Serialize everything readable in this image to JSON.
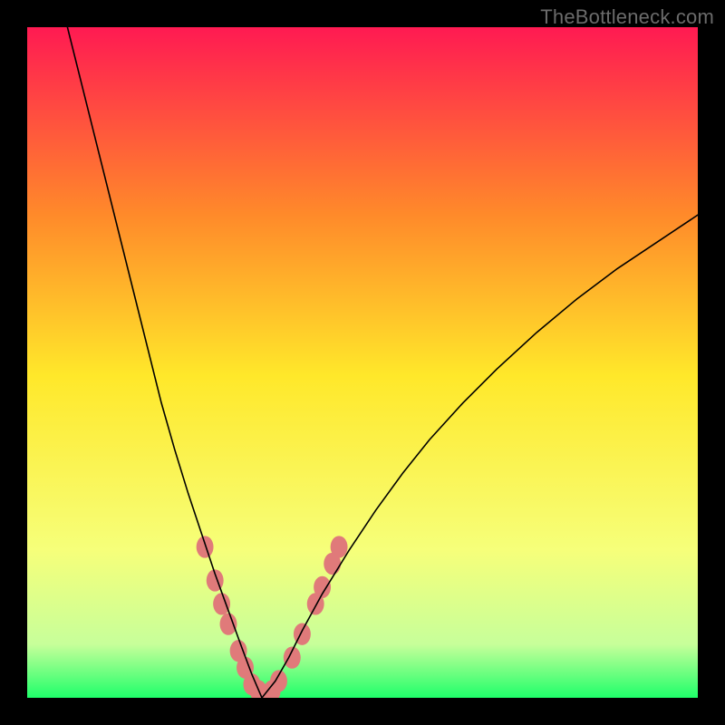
{
  "watermark": "TheBottleneck.com",
  "chart_data": {
    "type": "line",
    "title": "",
    "xlabel": "",
    "ylabel": "",
    "xlim": [
      0,
      100
    ],
    "ylim": [
      0,
      100
    ],
    "background_gradient": {
      "top": "#ff1a52",
      "mid_upper": "#ff8a2a",
      "mid": "#ffe82a",
      "mid_lower": "#f6ff7a",
      "lower": "#c7ff9a",
      "bottom": "#1fff6a"
    },
    "series": [
      {
        "name": "curve-left",
        "color": "#000000",
        "stroke_width": 1.6,
        "x": [
          6,
          8,
          10,
          12,
          14,
          16,
          18,
          20,
          22,
          24,
          26,
          28,
          30,
          32,
          33.5,
          35
        ],
        "y": [
          100,
          92,
          84,
          76,
          68,
          60,
          52,
          44,
          37,
          30.5,
          24.5,
          18.5,
          13,
          7.5,
          3.5,
          0
        ]
      },
      {
        "name": "curve-right",
        "color": "#000000",
        "stroke_width": 1.6,
        "x": [
          35,
          37,
          39,
          41,
          44,
          48,
          52,
          56,
          60,
          65,
          70,
          76,
          82,
          88,
          94,
          100
        ],
        "y": [
          0,
          2.5,
          6,
          10,
          15.5,
          22,
          28,
          33.5,
          38.5,
          44,
          49,
          54.5,
          59.5,
          64,
          68,
          72
        ]
      },
      {
        "name": "marker-band",
        "type": "scatter",
        "color": "#e07a7a",
        "marker_size_px": 18,
        "x": [
          26.5,
          28.0,
          29.0,
          30.0,
          31.5,
          32.5,
          33.5,
          34.5,
          36.5,
          37.5,
          39.5,
          41.0,
          43.0,
          44.0,
          45.5,
          46.5
        ],
        "y": [
          22.5,
          17.5,
          14.0,
          11.0,
          7.0,
          4.5,
          2.0,
          1.0,
          1.0,
          2.5,
          6.0,
          9.5,
          14.0,
          16.5,
          20.0,
          22.5
        ]
      }
    ],
    "annotations": []
  }
}
